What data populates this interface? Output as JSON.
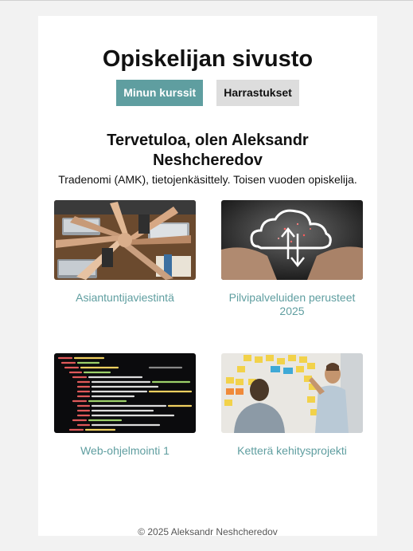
{
  "header": {
    "title": "Opiskelijan sivusto",
    "nav": [
      {
        "label": "Minun kurssit",
        "active": true
      },
      {
        "label": "Harrastukset",
        "active": false
      }
    ]
  },
  "intro": {
    "heading": "Tervetuloa, olen Aleksandr Neshcheredov",
    "description": "Tradenomi (AMK), tietojenkäsittely. Toisen vuoden opiskelija."
  },
  "courses": [
    {
      "title": "Asiantuntijaviestintä",
      "image": "team-hands-meeting-photo"
    },
    {
      "title": "Pilvipalveluiden perusteet 2025",
      "image": "cloud-upload-hands-photo"
    },
    {
      "title": "Web-ohjelmointi 1",
      "image": "html-code-screen-photo"
    },
    {
      "title": "Ketterä kehitysprojekti",
      "image": "sticky-notes-whiteboard-photo"
    }
  ],
  "footer": {
    "text": "© 2025 Aleksandr Neshcheredov"
  },
  "colors": {
    "accent": "#5f9ea0",
    "inactive_button": "#dddddd",
    "page_bg": "#f2f2f2"
  }
}
